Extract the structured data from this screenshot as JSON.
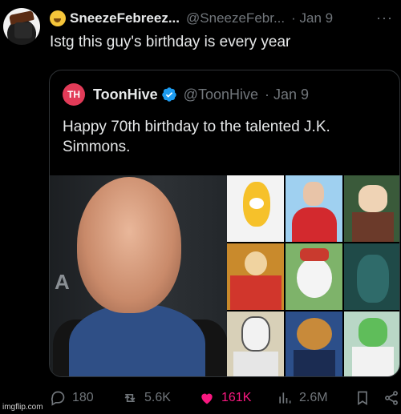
{
  "tweet": {
    "display_name": "SneezeFebreez...",
    "handle": "@SneezeFebr...",
    "date": "· Jan 9",
    "text": "Istg this guy's birthday is every year",
    "more_icon": "more-icon"
  },
  "quote": {
    "avatar_text": "TH",
    "display_name": "ToonHive",
    "handle": "@ToonHive",
    "date": "· Jan 9",
    "text": "Happy 70th birthday to the talented J.K. Simmons.",
    "photo_letters": "A R T",
    "brand_color": "#e23b58",
    "verified_color": "#1d9bf0"
  },
  "actions": {
    "replies": "180",
    "reposts": "5.6K",
    "likes": "161K",
    "views": "2.6M"
  },
  "colors": {
    "background": "#000000",
    "text": "#e7e9ea",
    "muted": "#71767b",
    "like": "#f91880",
    "border": "#2f3336"
  },
  "watermark": "imgflip.com"
}
